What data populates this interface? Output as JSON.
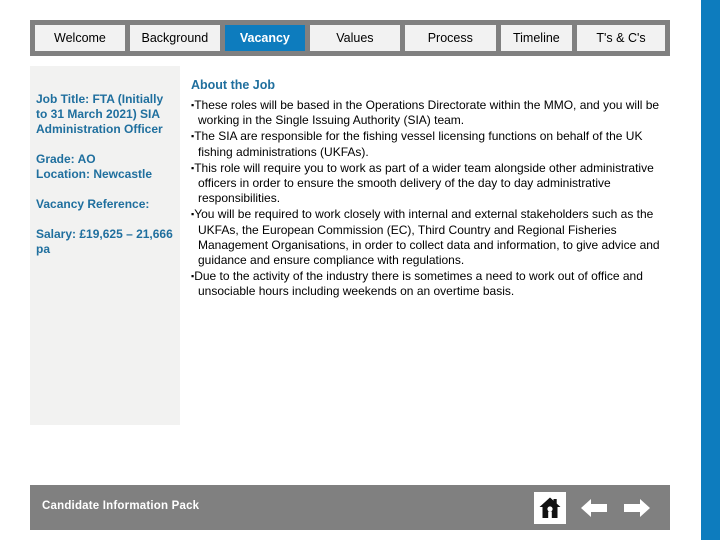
{
  "theme": {
    "accent_blue": "#0d7cbe",
    "heading_blue": "#1f6f9e",
    "bar_gray": "#808080",
    "panel_gray": "#f2f2f1",
    "tab_face": "#f2f2f2"
  },
  "tabs": [
    {
      "label": "Welcome",
      "active": false
    },
    {
      "label": "Background",
      "active": false
    },
    {
      "label": "Vacancy",
      "active": true
    },
    {
      "label": "Values",
      "active": false
    },
    {
      "label": "Process",
      "active": false
    },
    {
      "label": "Timeline",
      "active": false
    },
    {
      "label": "T's & C's",
      "active": false
    }
  ],
  "sidebar": {
    "blocks": [
      "Job Title: FTA (Initially to 31 March 2021) SIA Administration Officer",
      "Grade: AO\nLocation: Newcastle",
      "Vacancy Reference:",
      "Salary: £19,625 – 21,666 pa"
    ],
    "job_title": "Job Title: FTA (Initially to 31 March 2021) SIA Administration Officer",
    "grade": "Grade: AO",
    "location": "Location: Newcastle",
    "vacancy_reference": "Vacancy Reference:",
    "salary": "Salary: £19,625 – 21,666 pa"
  },
  "main": {
    "heading": "About the Job",
    "bullets": [
      "These roles will be based in the Operations Directorate within the MMO, and you will be working in the Single Issuing Authority (SIA) team.",
      "The SIA are responsible for the fishing vessel licensing functions on behalf of the UK fishing administrations (UKFAs).",
      "This role will require you to work as part of a wider team alongside other administrative officers in order to ensure the smooth delivery of the day to day administrative responsibilities.",
      "You will be required to work closely with internal and external stakeholders such as the UKFAs, the European Commission (EC), Third Country and Regional Fisheries Management Organisations, in order to collect data and information, to give advice and guidance and ensure compliance with regulations.",
      "Due to the activity of the industry there is sometimes a need to work out of office and unsociable hours including weekends on an overtime basis."
    ],
    "bullet_marker": "▪"
  },
  "footer": {
    "label": "Candidate Information Pack",
    "icons": [
      {
        "name": "home-icon",
        "title": "Home"
      },
      {
        "name": "arrow-left-icon",
        "title": "Previous"
      },
      {
        "name": "arrow-right-icon",
        "title": "Next"
      }
    ]
  }
}
